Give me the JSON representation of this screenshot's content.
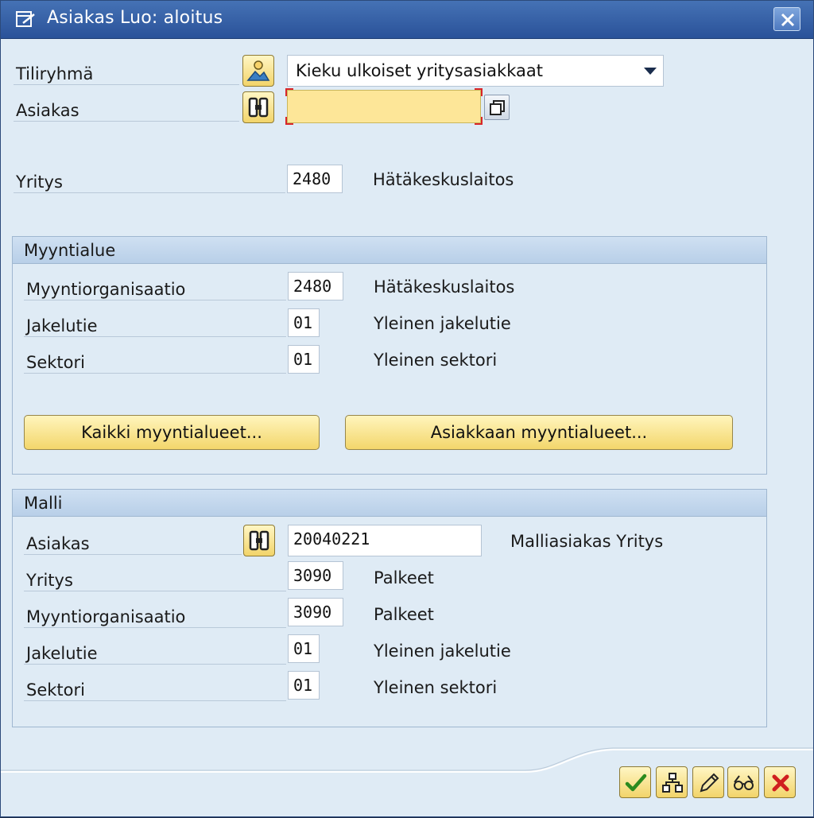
{
  "window": {
    "title": "Asiakas Luo: aloitus"
  },
  "top": {
    "account_group": {
      "label": "Tiliryhmä",
      "value": "Kieku ulkoiset yritysasiakkaat"
    },
    "customer": {
      "label": "Asiakas",
      "value": ""
    },
    "company": {
      "label": "Yritys",
      "value": "2480",
      "desc": "Hätäkeskuslaitos"
    }
  },
  "sales_area": {
    "header": "Myyntialue",
    "sales_org": {
      "label": "Myyntiorganisaatio",
      "value": "2480",
      "desc": "Hätäkeskuslaitos"
    },
    "distribution_channel": {
      "label": "Jakelutie",
      "value": "01",
      "desc": "Yleinen jakelutie"
    },
    "division": {
      "label": "Sektori",
      "value": "01",
      "desc": "Yleinen sektori"
    },
    "all_areas_button": "Kaikki myyntialueet...",
    "customer_areas_button": "Asiakkaan myyntialueet..."
  },
  "reference": {
    "header": "Malli",
    "customer": {
      "label": "Asiakas",
      "value": "20040221",
      "desc": "Malliasiakas Yritys"
    },
    "company": {
      "label": "Yritys",
      "value": "3090",
      "desc": "Palkeet"
    },
    "sales_org": {
      "label": "Myyntiorganisaatio",
      "value": "3090",
      "desc": "Palkeet"
    },
    "distribution_channel": {
      "label": "Jakelutie",
      "value": "01",
      "desc": "Yleinen jakelutie"
    },
    "division": {
      "label": "Sektori",
      "value": "01",
      "desc": "Yleinen sektori"
    }
  },
  "toolbar": {
    "icons": [
      "check-icon",
      "org-hierarchy-icon",
      "pencil-icon",
      "glasses-icon",
      "cancel-icon"
    ]
  },
  "colors": {
    "titlebar": "#2a5299",
    "required_field": "#fde698",
    "button": "#f3d66b",
    "background": "#dfebf5"
  }
}
